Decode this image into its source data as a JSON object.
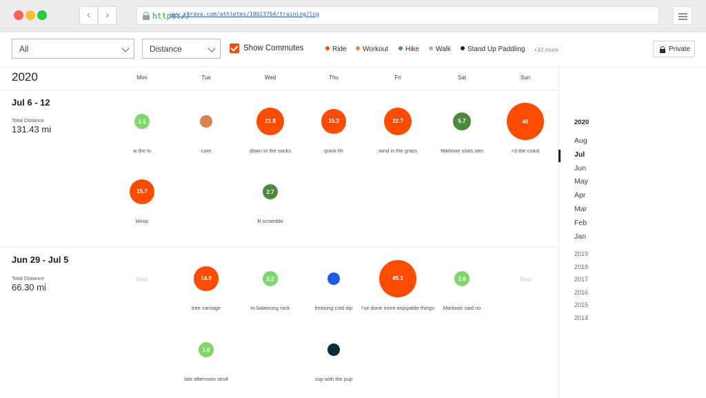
{
  "browser": {
    "url_scheme": "https://",
    "url_rest": "www.strava.com/athletes/10023764/training/log",
    "back_glyph": "‹",
    "forward_glyph": "›"
  },
  "toolbar": {
    "sport_filter": "All",
    "metric_filter": "Distance",
    "commutes_checked": true,
    "commutes_label": "Show Commutes",
    "legend": [
      {
        "label": "Ride",
        "color": "#fc4c02"
      },
      {
        "label": "Workout",
        "color": "#e08a4e"
      },
      {
        "label": "Hike",
        "color": "#4a9a3a"
      },
      {
        "label": "Walk",
        "color": "#7fd66a"
      },
      {
        "label": "Stand Up Paddling",
        "color": "#0d2a3a"
      }
    ],
    "more_label": "+32 more",
    "private_label": "Private"
  },
  "log": {
    "year": "2020",
    "days": [
      "Mon",
      "Tue",
      "Wed",
      "Thu",
      "Fri",
      "Sat",
      "Sun"
    ],
    "weeks": [
      {
        "title": "Jul 6 - 12",
        "total_label": "Total Distance",
        "total_value": "131.43 mi",
        "activities": [
          {
            "day": "Mon",
            "value": "1.1",
            "name": "w the lo",
            "color": "#7fd66a"
          },
          {
            "day": "Tue",
            "value": "",
            "name": "core",
            "color": "#d9844e"
          },
          {
            "day": "Wed",
            "value": "21.8",
            "name": "down to the socks",
            "color": "#fc4c02"
          },
          {
            "day": "Thu",
            "value": "15.3",
            "name": "quick hh",
            "color": "#fc4c02"
          },
          {
            "day": "Fri",
            "value": "22.7",
            "name": "wind in the grass",
            "color": "#fc4c02"
          },
          {
            "day": "Sat",
            "value": "5.7",
            "name": "Marlowe visits tam",
            "color": "#4a8a3a"
          },
          {
            "day": "Sun",
            "value": "46",
            "name": "<3 the coast",
            "color": "#fc4c02"
          },
          {
            "day": "Mon",
            "value": "15.7",
            "name": "bloop",
            "color": "#fc4c02"
          },
          {
            "day": "Wed",
            "value": "2.7",
            "name": "lil scramble",
            "color": "#4a8a3a"
          }
        ]
      },
      {
        "title": "Jun 29 - Jul 5",
        "total_label": "Total Distance",
        "total_value": "66.30 mi",
        "rest_label": "Rest",
        "activities": [
          {
            "day": "Tue",
            "value": "14.9",
            "name": "tree carnage",
            "color": "#fc4c02"
          },
          {
            "day": "Wed",
            "value": "2.2",
            "name": "to balancing rock",
            "color": "#7fd66a"
          },
          {
            "day": "Thu",
            "value": "",
            "name": "freezing cold dip",
            "color": "#1e5ae6"
          },
          {
            "day": "Fri",
            "value": "45.1",
            "name": "I've done more enjoyable things",
            "color": "#fc4c02"
          },
          {
            "day": "Sat",
            "value": "1.6",
            "name": "Marlowe said no",
            "color": "#7fd66a"
          },
          {
            "day": "Tue",
            "value": "1.6",
            "name": "late afternoon stroll",
            "color": "#7fd66a"
          },
          {
            "day": "Thu",
            "value": "",
            "name": "sup with the pup",
            "color": "#0d2a3a"
          }
        ]
      }
    ]
  },
  "sidebar": {
    "year": "2020",
    "months": [
      "Aug",
      "Jul",
      "Jun",
      "May",
      "Apr",
      "Mar",
      "Feb",
      "Jan"
    ],
    "active_month": "Jul",
    "years": [
      "2019",
      "2018",
      "2017",
      "2016",
      "2015",
      "2014"
    ]
  }
}
